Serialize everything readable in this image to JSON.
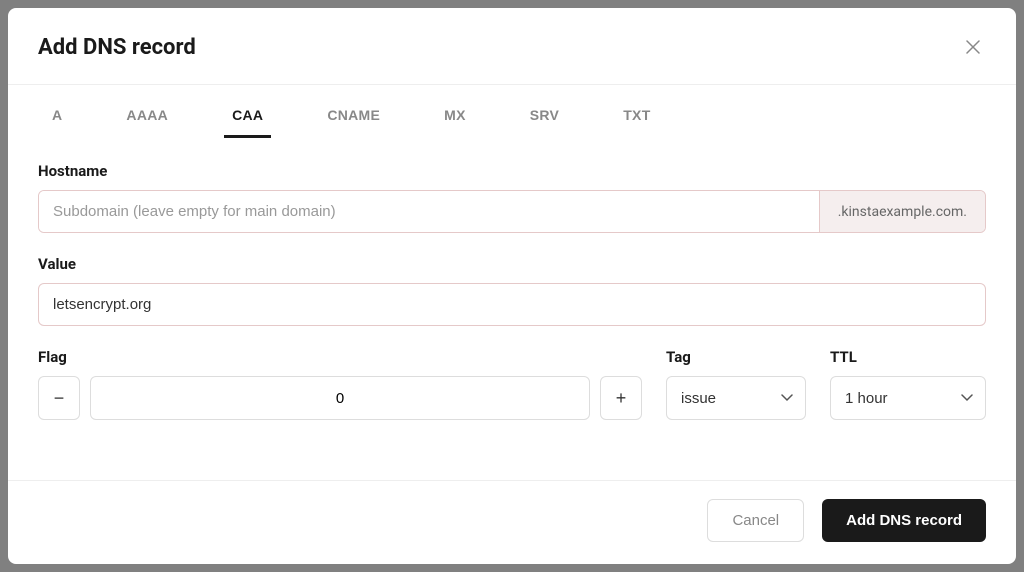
{
  "modal": {
    "title": "Add DNS record",
    "tabs": [
      {
        "label": "A",
        "active": false
      },
      {
        "label": "AAAA",
        "active": false
      },
      {
        "label": "CAA",
        "active": true
      },
      {
        "label": "CNAME",
        "active": false
      },
      {
        "label": "MX",
        "active": false
      },
      {
        "label": "SRV",
        "active": false
      },
      {
        "label": "TXT",
        "active": false
      }
    ],
    "hostname": {
      "label": "Hostname",
      "placeholder": "Subdomain (leave empty for main domain)",
      "value": "",
      "suffix": ".kinstaexample.com."
    },
    "value": {
      "label": "Value",
      "value": "letsencrypt.org"
    },
    "flag": {
      "label": "Flag",
      "value": "0"
    },
    "tag": {
      "label": "Tag",
      "selected": "issue"
    },
    "ttl": {
      "label": "TTL",
      "selected": "1 hour"
    },
    "buttons": {
      "cancel": "Cancel",
      "submit": "Add DNS record"
    }
  }
}
